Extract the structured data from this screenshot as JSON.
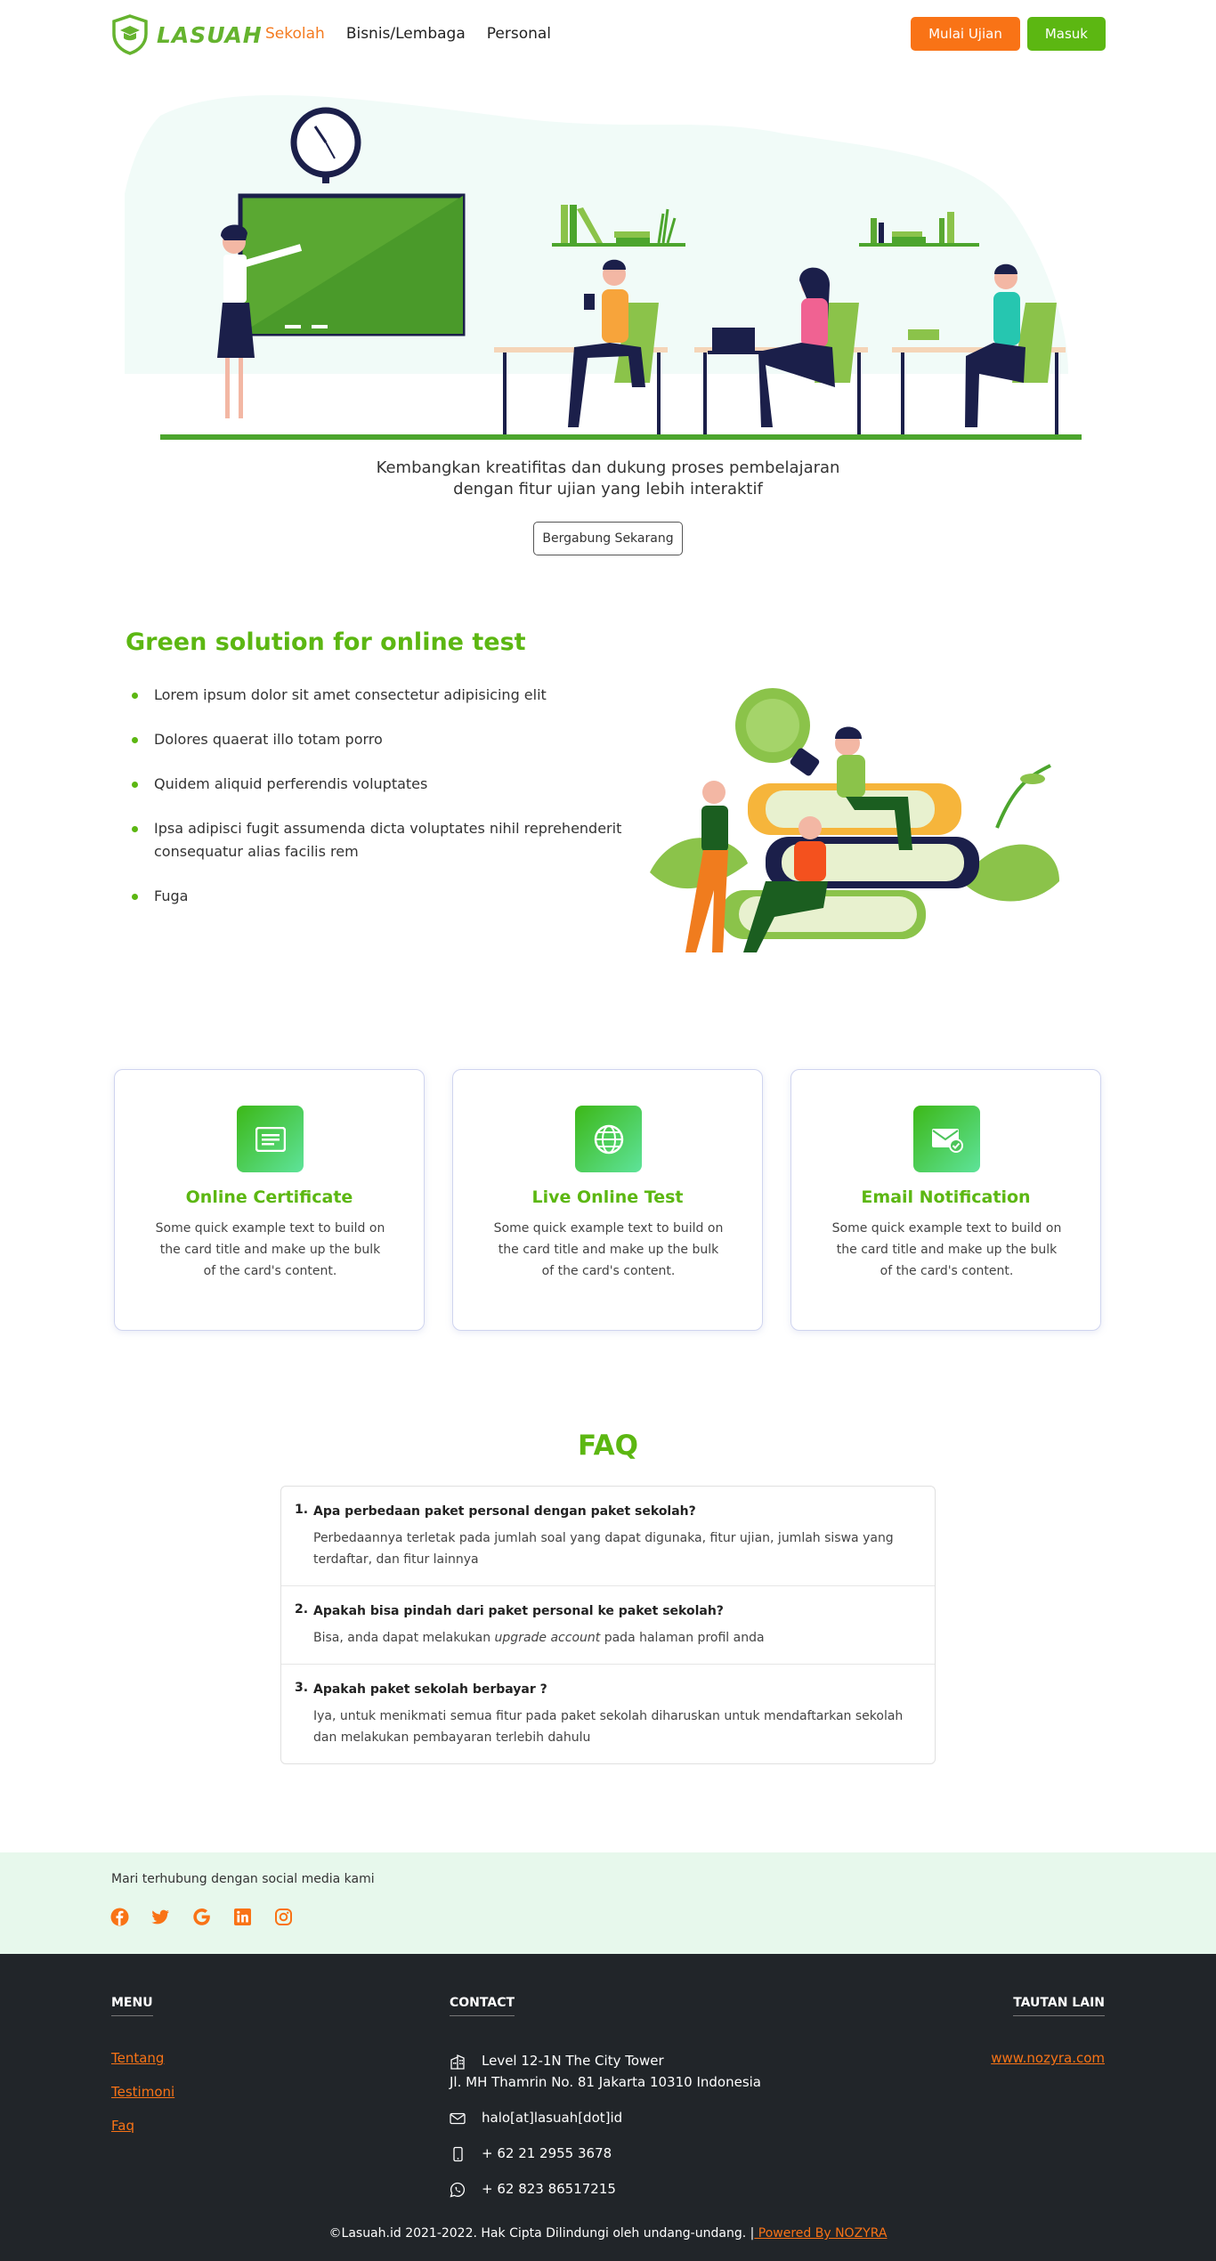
{
  "navbar": {
    "brand": "LASUAH",
    "links": [
      "Sekolah",
      "Bisnis/Lembaga",
      "Personal"
    ],
    "btn_start": "Mulai Ujian",
    "btn_login": "Masuk"
  },
  "hero": {
    "line1": "Kembangkan kreatifitas dan dukung proses pembelajaran",
    "line2": "dengan fitur ujian yang lebih interaktif",
    "cta": "Bergabung Sekarang"
  },
  "features": {
    "title": "Green solution for online test",
    "items": [
      "Lorem ipsum dolor sit amet consectetur adipisicing elit",
      "Dolores quaerat illo totam porro",
      "Quidem aliquid perferendis voluptates",
      "Ipsa adipisci fugit assumenda dicta voluptates nihil reprehenderit consequatur alias facilis rem",
      "Fuga"
    ]
  },
  "cards": [
    {
      "title": "Online Certificate",
      "text": "Some quick example text to build on the card title and make up the bulk of the card's content.",
      "icon": "certificate-icon"
    },
    {
      "title": "Live Online Test",
      "text": "Some quick example text to build on the card title and make up the bulk of the card's content.",
      "icon": "globe-icon"
    },
    {
      "title": "Email Notification",
      "text": "Some quick example text to build on the card title and make up the bulk of the card's content.",
      "icon": "email-check-icon"
    }
  ],
  "faq": {
    "title": "FAQ",
    "items": [
      {
        "num": "1.",
        "q": "Apa perbedaan paket personal dengan paket sekolah?",
        "a": "Perbedaannya terletak pada jumlah soal yang dapat digunaka, fitur ujian, jumlah siswa yang terdaftar, dan fitur lainnya"
      },
      {
        "num": "2.",
        "q": "Apakah bisa pindah dari paket personal ke paket sekolah?",
        "a_pre": "Bisa, anda dapat melakukan ",
        "a_em": "upgrade account",
        "a_post": " pada halaman profil anda"
      },
      {
        "num": "3.",
        "q": "Apakah paket sekolah berbayar ?",
        "a": "Iya, untuk menikmati semua fitur pada paket sekolah diharuskan untuk mendaftarkan sekolah dan melakukan pembayaran terlebih dahulu"
      }
    ]
  },
  "social": {
    "text": "Mari terhubung dengan social media kami",
    "icons": [
      "facebook-icon",
      "twitter-icon",
      "google-icon",
      "linkedin-icon",
      "instagram-icon"
    ],
    "color": "#f97316"
  },
  "footer": {
    "menu_title": "MENU",
    "menu_links": [
      "Tentang",
      "Testimoni",
      "Faq"
    ],
    "contact_title": "CONTACT",
    "address1": "Level 12-1N The City Tower",
    "address2": "Jl. MH Thamrin No. 81 Jakarta 10310 Indonesia",
    "email": "halo[at]lasuah[dot]id",
    "phone": "+ 62 21 2955 3678",
    "whatsapp": "+ 62 823 86517215",
    "other_title": "TAUTAN LAIN",
    "other_link": "www.nozyra.com",
    "copyright": "©Lasuah.id 2021-2022. Hak Cipta Dilindungi oleh undang-undang. |",
    "powered": " Powered By NOZYRA"
  },
  "colors": {
    "green": "#5cb712",
    "orange": "#f97316",
    "dark": "#212529",
    "mint": "#e7f8ec"
  }
}
